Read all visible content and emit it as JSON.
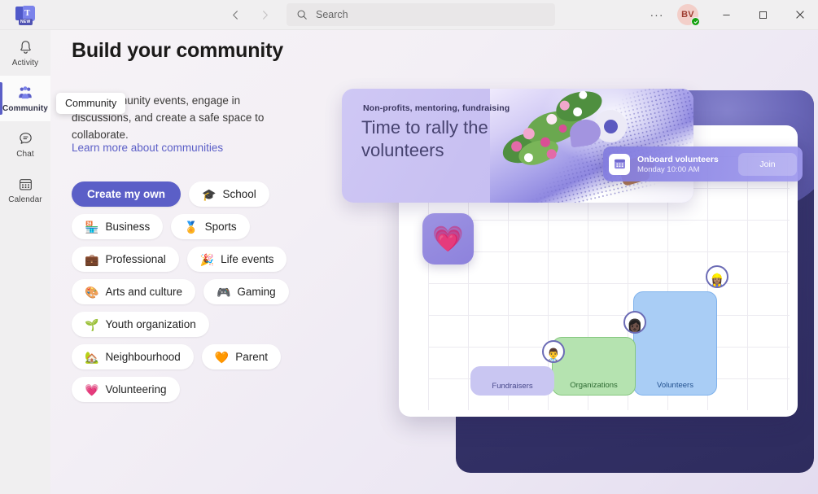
{
  "titlebar": {
    "logo_badge": "NEW",
    "logo_letter": "T",
    "back_icon": "chevron-left-icon",
    "forward_icon": "chevron-right-icon",
    "search_placeholder": "Search",
    "search_value": "",
    "more_label": "···",
    "avatar_initials": "BV",
    "presence": "available",
    "minimize": "─",
    "maximize": "□",
    "close": "✕"
  },
  "rail": {
    "items": [
      {
        "label": "Activity",
        "icon": "bell-icon",
        "active": false
      },
      {
        "label": "Community",
        "icon": "people-icon",
        "active": true
      },
      {
        "label": "Chat",
        "icon": "chat-icon",
        "active": false
      },
      {
        "label": "Calendar",
        "icon": "calendar-icon",
        "active": false
      }
    ]
  },
  "tooltip": {
    "text": "Community"
  },
  "page": {
    "title": "Build your community",
    "description": "Host community events, engage in discussions, and create a safe space to collaborate.",
    "learn_more": "Learn more about communities"
  },
  "chips": [
    {
      "label": "Create my own",
      "emoji": "",
      "primary": true
    },
    {
      "label": "School",
      "emoji": "🎓",
      "primary": false
    },
    {
      "label": "Business",
      "emoji": "🏪",
      "primary": false
    },
    {
      "label": "Sports",
      "emoji": "🏅",
      "primary": false
    },
    {
      "label": "Professional",
      "emoji": "💼",
      "primary": false
    },
    {
      "label": "Life events",
      "emoji": "🎉",
      "primary": false
    },
    {
      "label": "Arts and culture",
      "emoji": "🎨",
      "primary": false
    },
    {
      "label": "Gaming",
      "emoji": "🎮",
      "primary": false
    },
    {
      "label": "Youth organization",
      "emoji": "🌱",
      "primary": false
    },
    {
      "label": "Neighbourhood",
      "emoji": "🏡",
      "primary": false
    },
    {
      "label": "Parent",
      "emoji": "🧡",
      "primary": false
    },
    {
      "label": "Volunteering",
      "emoji": "💗",
      "primary": false
    }
  ],
  "illustration": {
    "hero": {
      "kicker": "Non-profits, mentoring, fundraising",
      "title": "Time to rally the volunteers"
    },
    "onboard": {
      "title": "Onboard volunteers",
      "subtitle": "Monday 10:00 AM",
      "join_label": "Join",
      "icon": "calendar-icon"
    },
    "heart_tile": {
      "emoji": "💗"
    },
    "diagram": {
      "blocks": [
        {
          "label": "Fundraisers",
          "color": "#c9c6f2"
        },
        {
          "label": "Organizations",
          "color": "#b5e3b0"
        },
        {
          "label": "Volunteers",
          "color": "#a9cdf5"
        }
      ],
      "avatars": [
        "👨‍⚕️",
        "👩🏿",
        "👷🏽‍♀️"
      ]
    }
  },
  "colors": {
    "accent": "#5b5fc7",
    "navy_panel": "#35336b",
    "hero_card": "#c8c0f2",
    "presence_green": "#13a10e"
  }
}
